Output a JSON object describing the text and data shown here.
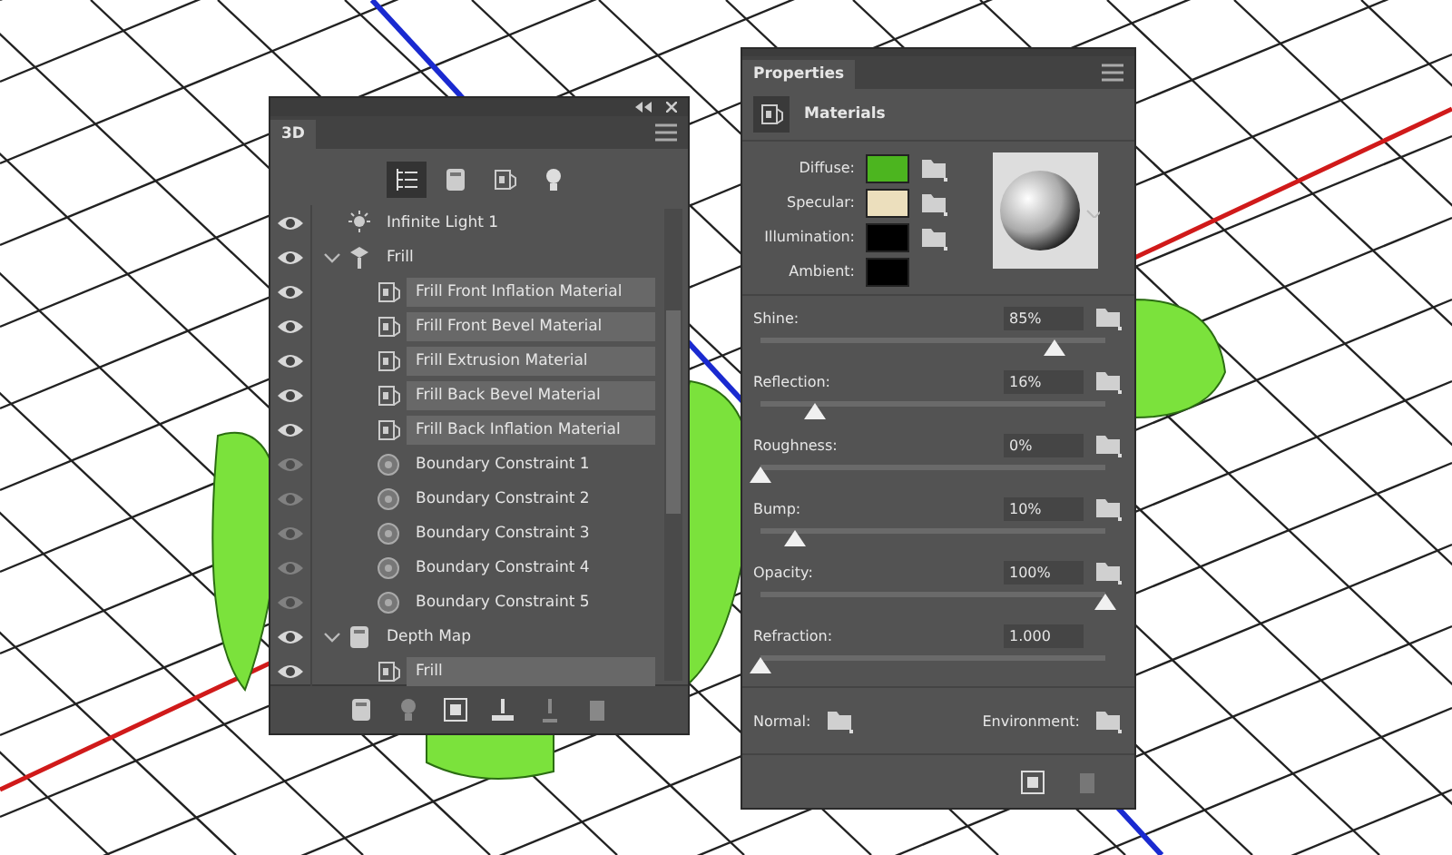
{
  "panel_3d": {
    "tab": "3D",
    "filters": [
      {
        "selected": true
      },
      {
        "selected": false
      },
      {
        "selected": false
      },
      {
        "selected": false
      }
    ],
    "layers": [
      {
        "kind": "light",
        "name": "Infinite Light 1",
        "visible": true,
        "selected": false
      },
      {
        "kind": "mesh",
        "name": "Frill",
        "visible": true,
        "selected": false,
        "expanded": true,
        "children": [
          {
            "kind": "material",
            "name": "Frill Front Inflation Material",
            "visible": true,
            "selected": true
          },
          {
            "kind": "material",
            "name": "Frill Front Bevel Material",
            "visible": true,
            "selected": true
          },
          {
            "kind": "material",
            "name": "Frill Extrusion Material",
            "visible": true,
            "selected": true
          },
          {
            "kind": "material",
            "name": "Frill Back Bevel Material",
            "visible": true,
            "selected": true
          },
          {
            "kind": "material",
            "name": "Frill Back Inflation Material",
            "visible": true,
            "selected": true
          },
          {
            "kind": "constraint",
            "name": "Boundary Constraint 1",
            "visible": false,
            "selected": false
          },
          {
            "kind": "constraint",
            "name": "Boundary Constraint 2",
            "visible": false,
            "selected": false
          },
          {
            "kind": "constraint",
            "name": "Boundary Constraint 3",
            "visible": false,
            "selected": false
          },
          {
            "kind": "constraint",
            "name": "Boundary Constraint 4",
            "visible": false,
            "selected": false
          },
          {
            "kind": "constraint",
            "name": "Boundary Constraint 5",
            "visible": false,
            "selected": false
          }
        ]
      },
      {
        "kind": "map",
        "name": "Depth Map",
        "visible": true,
        "selected": false,
        "expanded": true,
        "children": [
          {
            "kind": "material",
            "name": "Frill",
            "visible": true,
            "selected": true
          }
        ]
      }
    ]
  },
  "properties": {
    "tab": "Properties",
    "header": "Materials",
    "swatches": [
      {
        "label": "Diffuse:",
        "color": "#4cb51f",
        "texture_button": true
      },
      {
        "label": "Specular:",
        "color": "#ecdfbd",
        "texture_button": true
      },
      {
        "label": "Illumination:",
        "color": "#000000",
        "texture_button": true
      },
      {
        "label": "Ambient:",
        "color": "#000000",
        "texture_button": false
      }
    ],
    "sliders": [
      {
        "label": "Shine:",
        "value": "85%",
        "level": 0.85,
        "texture_button": true
      },
      {
        "label": "Reflection:",
        "value": "16%",
        "level": 0.16,
        "texture_button": true
      },
      {
        "label": "Roughness:",
        "value": "0%",
        "level": 0,
        "texture_button": true
      },
      {
        "label": "Bump:",
        "value": "10%",
        "level": 0.1,
        "texture_button": true
      },
      {
        "label": "Opacity:",
        "value": "100%",
        "level": 1,
        "texture_button": true
      },
      {
        "label": "Refraction:",
        "value": "1.000",
        "level": 0,
        "texture_button": false
      }
    ],
    "maps": [
      {
        "label": "Normal:"
      },
      {
        "label": "Environment:"
      }
    ]
  }
}
